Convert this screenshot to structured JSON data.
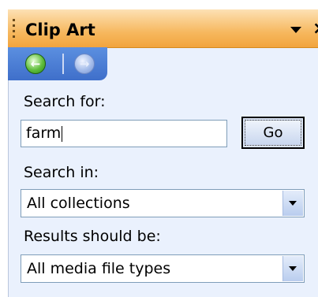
{
  "panel": {
    "title": "Clip Art",
    "menu_icon": "dropdown-arrow-icon",
    "close_icon": "close-icon"
  },
  "nav": {
    "back_icon": "back-arrow-icon",
    "forward_icon": "forward-arrow-icon"
  },
  "search": {
    "label": "Search for:",
    "value": "farm",
    "go_label": "Go"
  },
  "search_in": {
    "label": "Search in:",
    "selected": "All collections"
  },
  "results": {
    "label": "Results should be:",
    "selected": "All media file types"
  }
}
